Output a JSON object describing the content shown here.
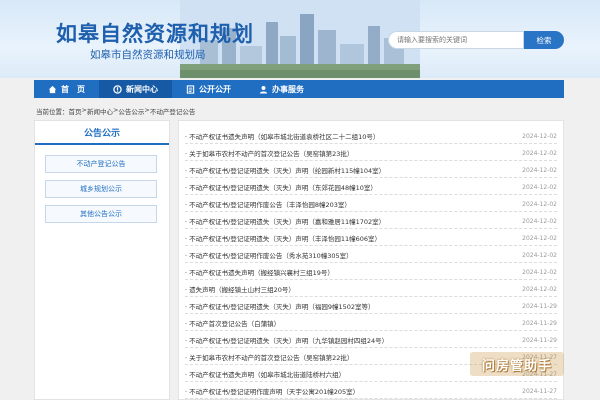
{
  "header": {
    "title": "如皋自然资源和规划",
    "subtitle": "如皋市自然资源和规划局",
    "search_placeholder": "请输入要搜索的关键词",
    "search_button": "检索"
  },
  "nav": {
    "items": [
      {
        "label": "首　页",
        "icon": "home-icon"
      },
      {
        "label": "新闻中心",
        "icon": "news-icon"
      },
      {
        "label": "公开公开",
        "icon": "public-icon"
      },
      {
        "label": "办事服务",
        "icon": "service-icon"
      }
    ]
  },
  "breadcrumb": {
    "prefix": "当前位置：",
    "items": [
      "首页",
      "新闻中心",
      "公告公示",
      "不动产登记公告"
    ],
    "separator": " > "
  },
  "sidebar": {
    "title": "公告公示",
    "items": [
      "不动产登记公告",
      "城乡规划公示",
      "其他公告公示"
    ]
  },
  "list": [
    {
      "title": "· 不动产权证书遗失声明（如皋市城北街道袁桥社区二十二组10号）",
      "date": "2024-12-02"
    },
    {
      "title": "· 关于如皋市农村不动产的首次登记公告（吴窑镇第23批）",
      "date": "2024-12-02"
    },
    {
      "title": "· 不动产权证书/登记证明遗失（灭失）声明（纶园新村115幢104室）",
      "date": "2024-12-02"
    },
    {
      "title": "· 不动产权证书/登记证明遗失（灭失）声明（东郊花园48幢10室）",
      "date": "2024-12-02"
    },
    {
      "title": "· 不动产权证书/登记证明作废公告（丰泽怡园8幢203室）",
      "date": "2024-12-02"
    },
    {
      "title": "· 不动产权证书/登记证明遗失（灭失）声明（嘉和雅居11幢1702室）",
      "date": "2024-12-02"
    },
    {
      "title": "· 不动产权证书/登记证明遗失（灭失）声明（丰泽怡园11幢606室）",
      "date": "2024-12-02"
    },
    {
      "title": "· 不动产权证书/登记证明作废公告（秀水苑310幢305室）",
      "date": "2024-12-02"
    },
    {
      "title": "· 不动产权证书遗失声明（搬经镇兴襄村三组19号）",
      "date": "2024-12-02"
    },
    {
      "title": "· 遗失声明（搬经镇土山村三组20号）",
      "date": "2024-12-02"
    },
    {
      "title": "· 不动产权证书/登记证明遗失（灭失）声明（福园9幢1502室等）",
      "date": "2024-11-29"
    },
    {
      "title": "· 不动产首次登记公告（白蒲镇）",
      "date": "2024-11-29"
    },
    {
      "title": "· 不动产权证书/登记证明遗失（灭失）声明（九华镇赵园村四组24号）",
      "date": "2024-11-29"
    },
    {
      "title": "· 关于如皋市农村不动产的首次登记公告（吴窑镇第22批）",
      "date": "2024-11-27"
    },
    {
      "title": "· 不动产权证书遗失声明（如皋市城北街道陆桥村六组）",
      "date": "2024-11-27"
    },
    {
      "title": "· 不动产权证书/登记证明作废声明（天宇公寓201幢205室）",
      "date": "2024-11-27"
    }
  ],
  "watermark": "问房管助手",
  "colors": {
    "brand": "#1f6ec2",
    "title": "#1e5fae",
    "date": "#999999"
  }
}
